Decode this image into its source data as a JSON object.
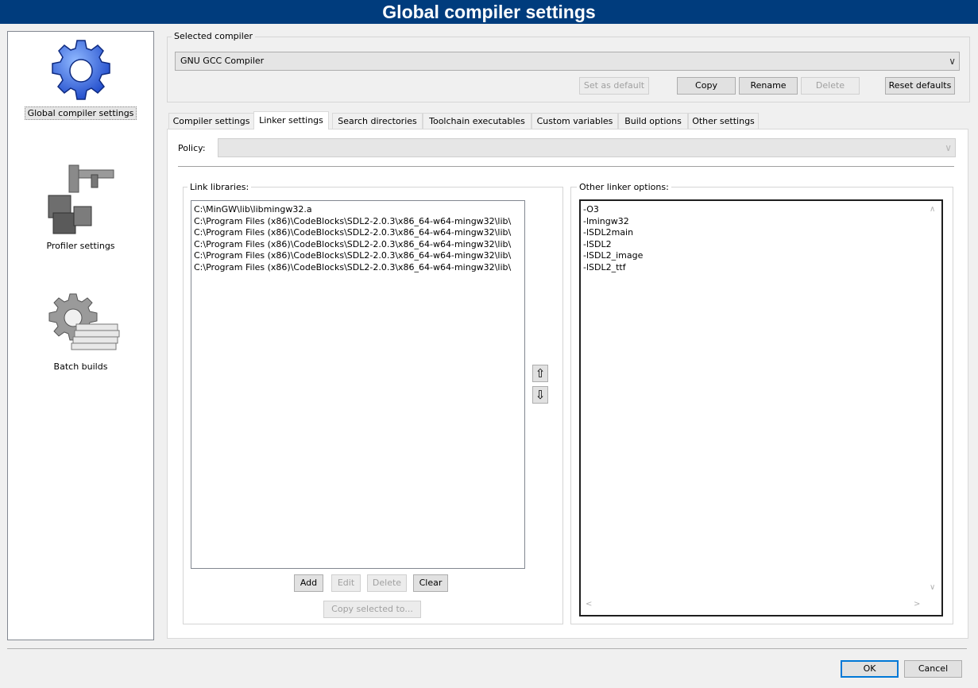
{
  "window": {
    "title": "Global compiler settings"
  },
  "sidebar": {
    "items": [
      {
        "label": "Global compiler settings",
        "icon": "gear-icon",
        "selected": true
      },
      {
        "label": "Profiler settings",
        "icon": "profiler-icon",
        "selected": false
      },
      {
        "label": "Batch builds",
        "icon": "batch-builds-icon",
        "selected": false
      }
    ]
  },
  "compiler": {
    "group_label": "Selected compiler",
    "selected": "GNU GCC Compiler",
    "buttons": {
      "set_default": "Set as default",
      "copy": "Copy",
      "rename": "Rename",
      "delete": "Delete",
      "reset": "Reset defaults"
    }
  },
  "tabs": [
    {
      "label": "Compiler settings",
      "active": false
    },
    {
      "label": "Linker settings",
      "active": true
    },
    {
      "label": "Search directories",
      "active": false
    },
    {
      "label": "Toolchain executables",
      "active": false
    },
    {
      "label": "Custom variables",
      "active": false
    },
    {
      "label": "Build options",
      "active": false
    },
    {
      "label": "Other settings",
      "active": false
    }
  ],
  "linker": {
    "policy_label": "Policy:",
    "policy_value": "",
    "link_libraries": {
      "label": "Link libraries:",
      "items": [
        "C:\\MinGW\\lib\\libmingw32.a",
        "C:\\Program Files (x86)\\CodeBlocks\\SDL2-2.0.3\\x86_64-w64-mingw32\\lib\\",
        "C:\\Program Files (x86)\\CodeBlocks\\SDL2-2.0.3\\x86_64-w64-mingw32\\lib\\",
        "C:\\Program Files (x86)\\CodeBlocks\\SDL2-2.0.3\\x86_64-w64-mingw32\\lib\\",
        "C:\\Program Files (x86)\\CodeBlocks\\SDL2-2.0.3\\x86_64-w64-mingw32\\lib\\",
        "C:\\Program Files (x86)\\CodeBlocks\\SDL2-2.0.3\\x86_64-w64-mingw32\\lib\\"
      ],
      "buttons": {
        "add": "Add",
        "edit": "Edit",
        "delete": "Delete",
        "clear": "Clear",
        "copy_selected": "Copy selected to..."
      }
    },
    "move_up_icon": "⇧",
    "move_down_icon": "⇩",
    "other_options": {
      "label": "Other linker options:",
      "lines": [
        "-O3",
        "-lmingw32",
        "-lSDL2main",
        "-lSDL2",
        "-lSDL2_image",
        "-lSDL2_ttf"
      ]
    }
  },
  "footer": {
    "ok": "OK",
    "cancel": "Cancel"
  },
  "colors": {
    "titlebar": "#003c7d",
    "accent": "#0078d7"
  }
}
